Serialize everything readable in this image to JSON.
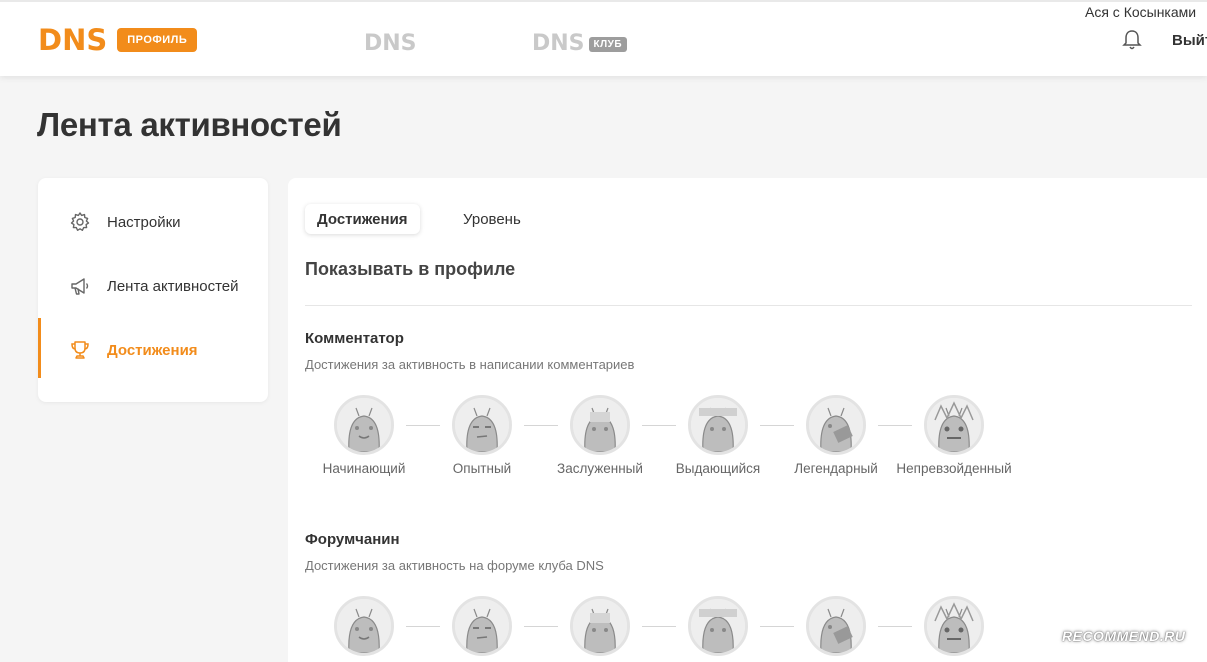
{
  "header": {
    "logo_text": "DNS",
    "profile_badge": "ПРОФИЛЬ",
    "logo2_text": "DNS",
    "club_logo_text": "DNS",
    "club_badge": "КЛУБ",
    "user_name": "Ася с Косынками",
    "logout_label": "Выйти"
  },
  "page": {
    "title": "Лента активностей"
  },
  "sidebar": {
    "items": [
      {
        "label": "Настройки",
        "icon": "gear-icon",
        "active": false
      },
      {
        "label": "Лента активностей",
        "icon": "megaphone-icon",
        "active": false
      },
      {
        "label": "Достижения",
        "icon": "trophy-icon",
        "active": true
      }
    ]
  },
  "tabs": [
    {
      "label": "Достижения",
      "active": true
    },
    {
      "label": "Уровень",
      "active": false
    }
  ],
  "main": {
    "section_title": "Показывать в профиле",
    "groups": [
      {
        "title": "Комментатор",
        "description": "Достижения за активность в написании комментариев",
        "badges": [
          "Начинающий",
          "Опытный",
          "Заслуженный",
          "Выдающийся",
          "Легендарный",
          "Непревзойденный"
        ]
      },
      {
        "title": "Форумчанин",
        "description": "Достижения за активность на форуме клуба DNS",
        "badges": [
          "",
          "",
          "",
          "",
          "",
          ""
        ]
      }
    ]
  },
  "colors": {
    "accent": "#f28c1b",
    "background": "#f5f5f5",
    "card": "#ffffff"
  },
  "watermark": "RECOMMEND.RU"
}
